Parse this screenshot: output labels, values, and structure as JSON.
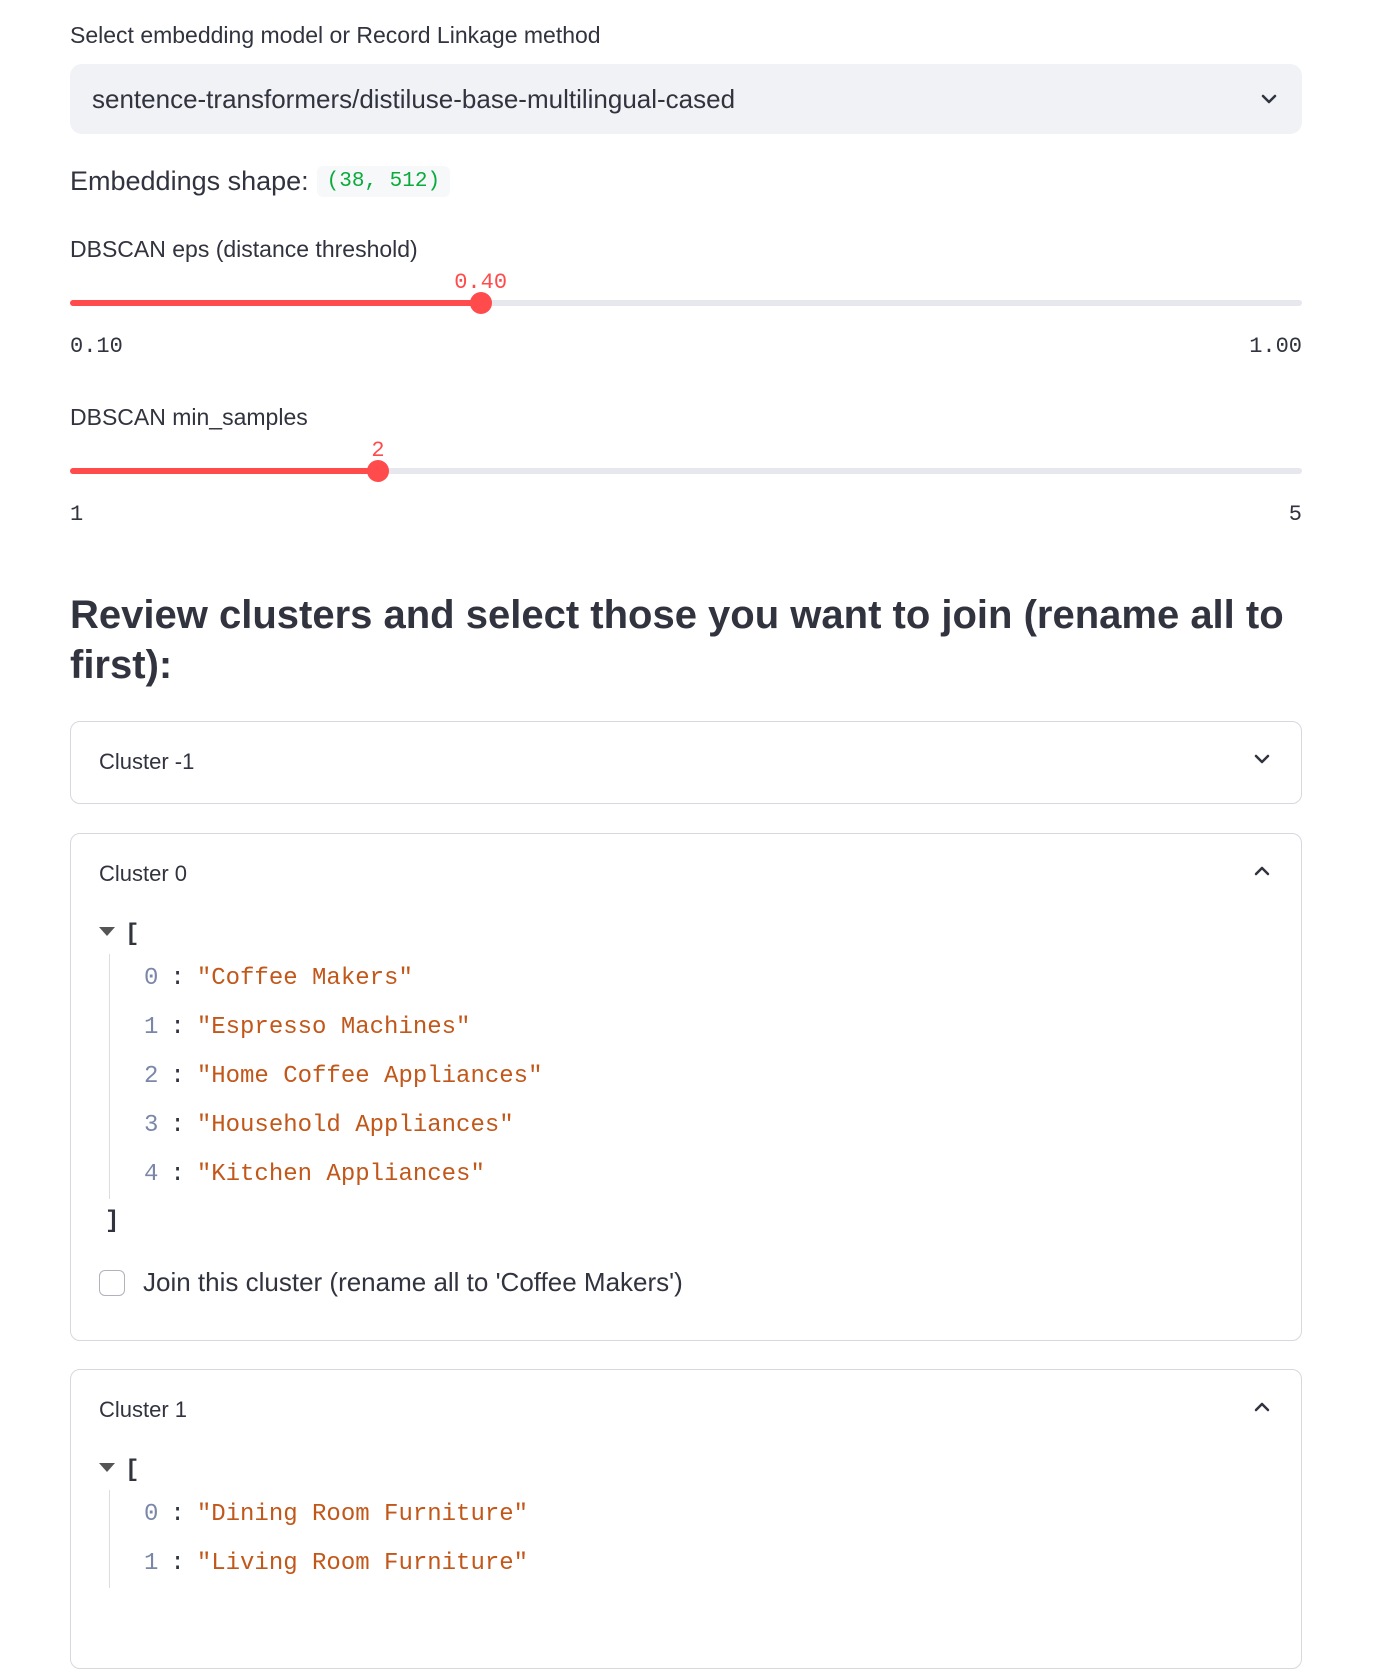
{
  "model_select": {
    "label": "Select embedding model or Record Linkage method",
    "value": "sentence-transformers/distiluse-base-multilingual-cased",
    "icon": "chevron-down-icon"
  },
  "embeddings": {
    "label": "Embeddings shape:",
    "value": "(38, 512)"
  },
  "eps_slider": {
    "label": "DBSCAN eps (distance threshold)",
    "value": "0.40",
    "min": "0.10",
    "max": "1.00",
    "fraction": 0.3333
  },
  "min_samples_slider": {
    "label": "DBSCAN min_samples",
    "value": "2",
    "min": "1",
    "max": "5",
    "fraction": 0.25
  },
  "heading": "Review clusters and select those you want to join (rename all to first):",
  "clusters": [
    {
      "title": "Cluster -1",
      "expanded": false
    },
    {
      "title": "Cluster 0",
      "expanded": true,
      "open_bracket": "[",
      "close_bracket": "]",
      "items": [
        {
          "index": "0",
          "value": "\"Coffee Makers\""
        },
        {
          "index": "1",
          "value": "\"Espresso Machines\""
        },
        {
          "index": "2",
          "value": "\"Home Coffee Appliances\""
        },
        {
          "index": "3",
          "value": "\"Household Appliances\""
        },
        {
          "index": "4",
          "value": "\"Kitchen Appliances\""
        }
      ],
      "join_label": "Join this cluster (rename all to 'Coffee Makers')"
    },
    {
      "title": "Cluster 1",
      "expanded": true,
      "open_bracket": "[",
      "items": [
        {
          "index": "0",
          "value": "\"Dining Room Furniture\""
        },
        {
          "index": "1",
          "value": "\"Living Room Furniture\""
        }
      ]
    }
  ],
  "colors": {
    "accent": "#ff4b4b",
    "code_green": "#09ab3b",
    "json_string": "#c2571a",
    "json_index": "#7b87a8"
  }
}
